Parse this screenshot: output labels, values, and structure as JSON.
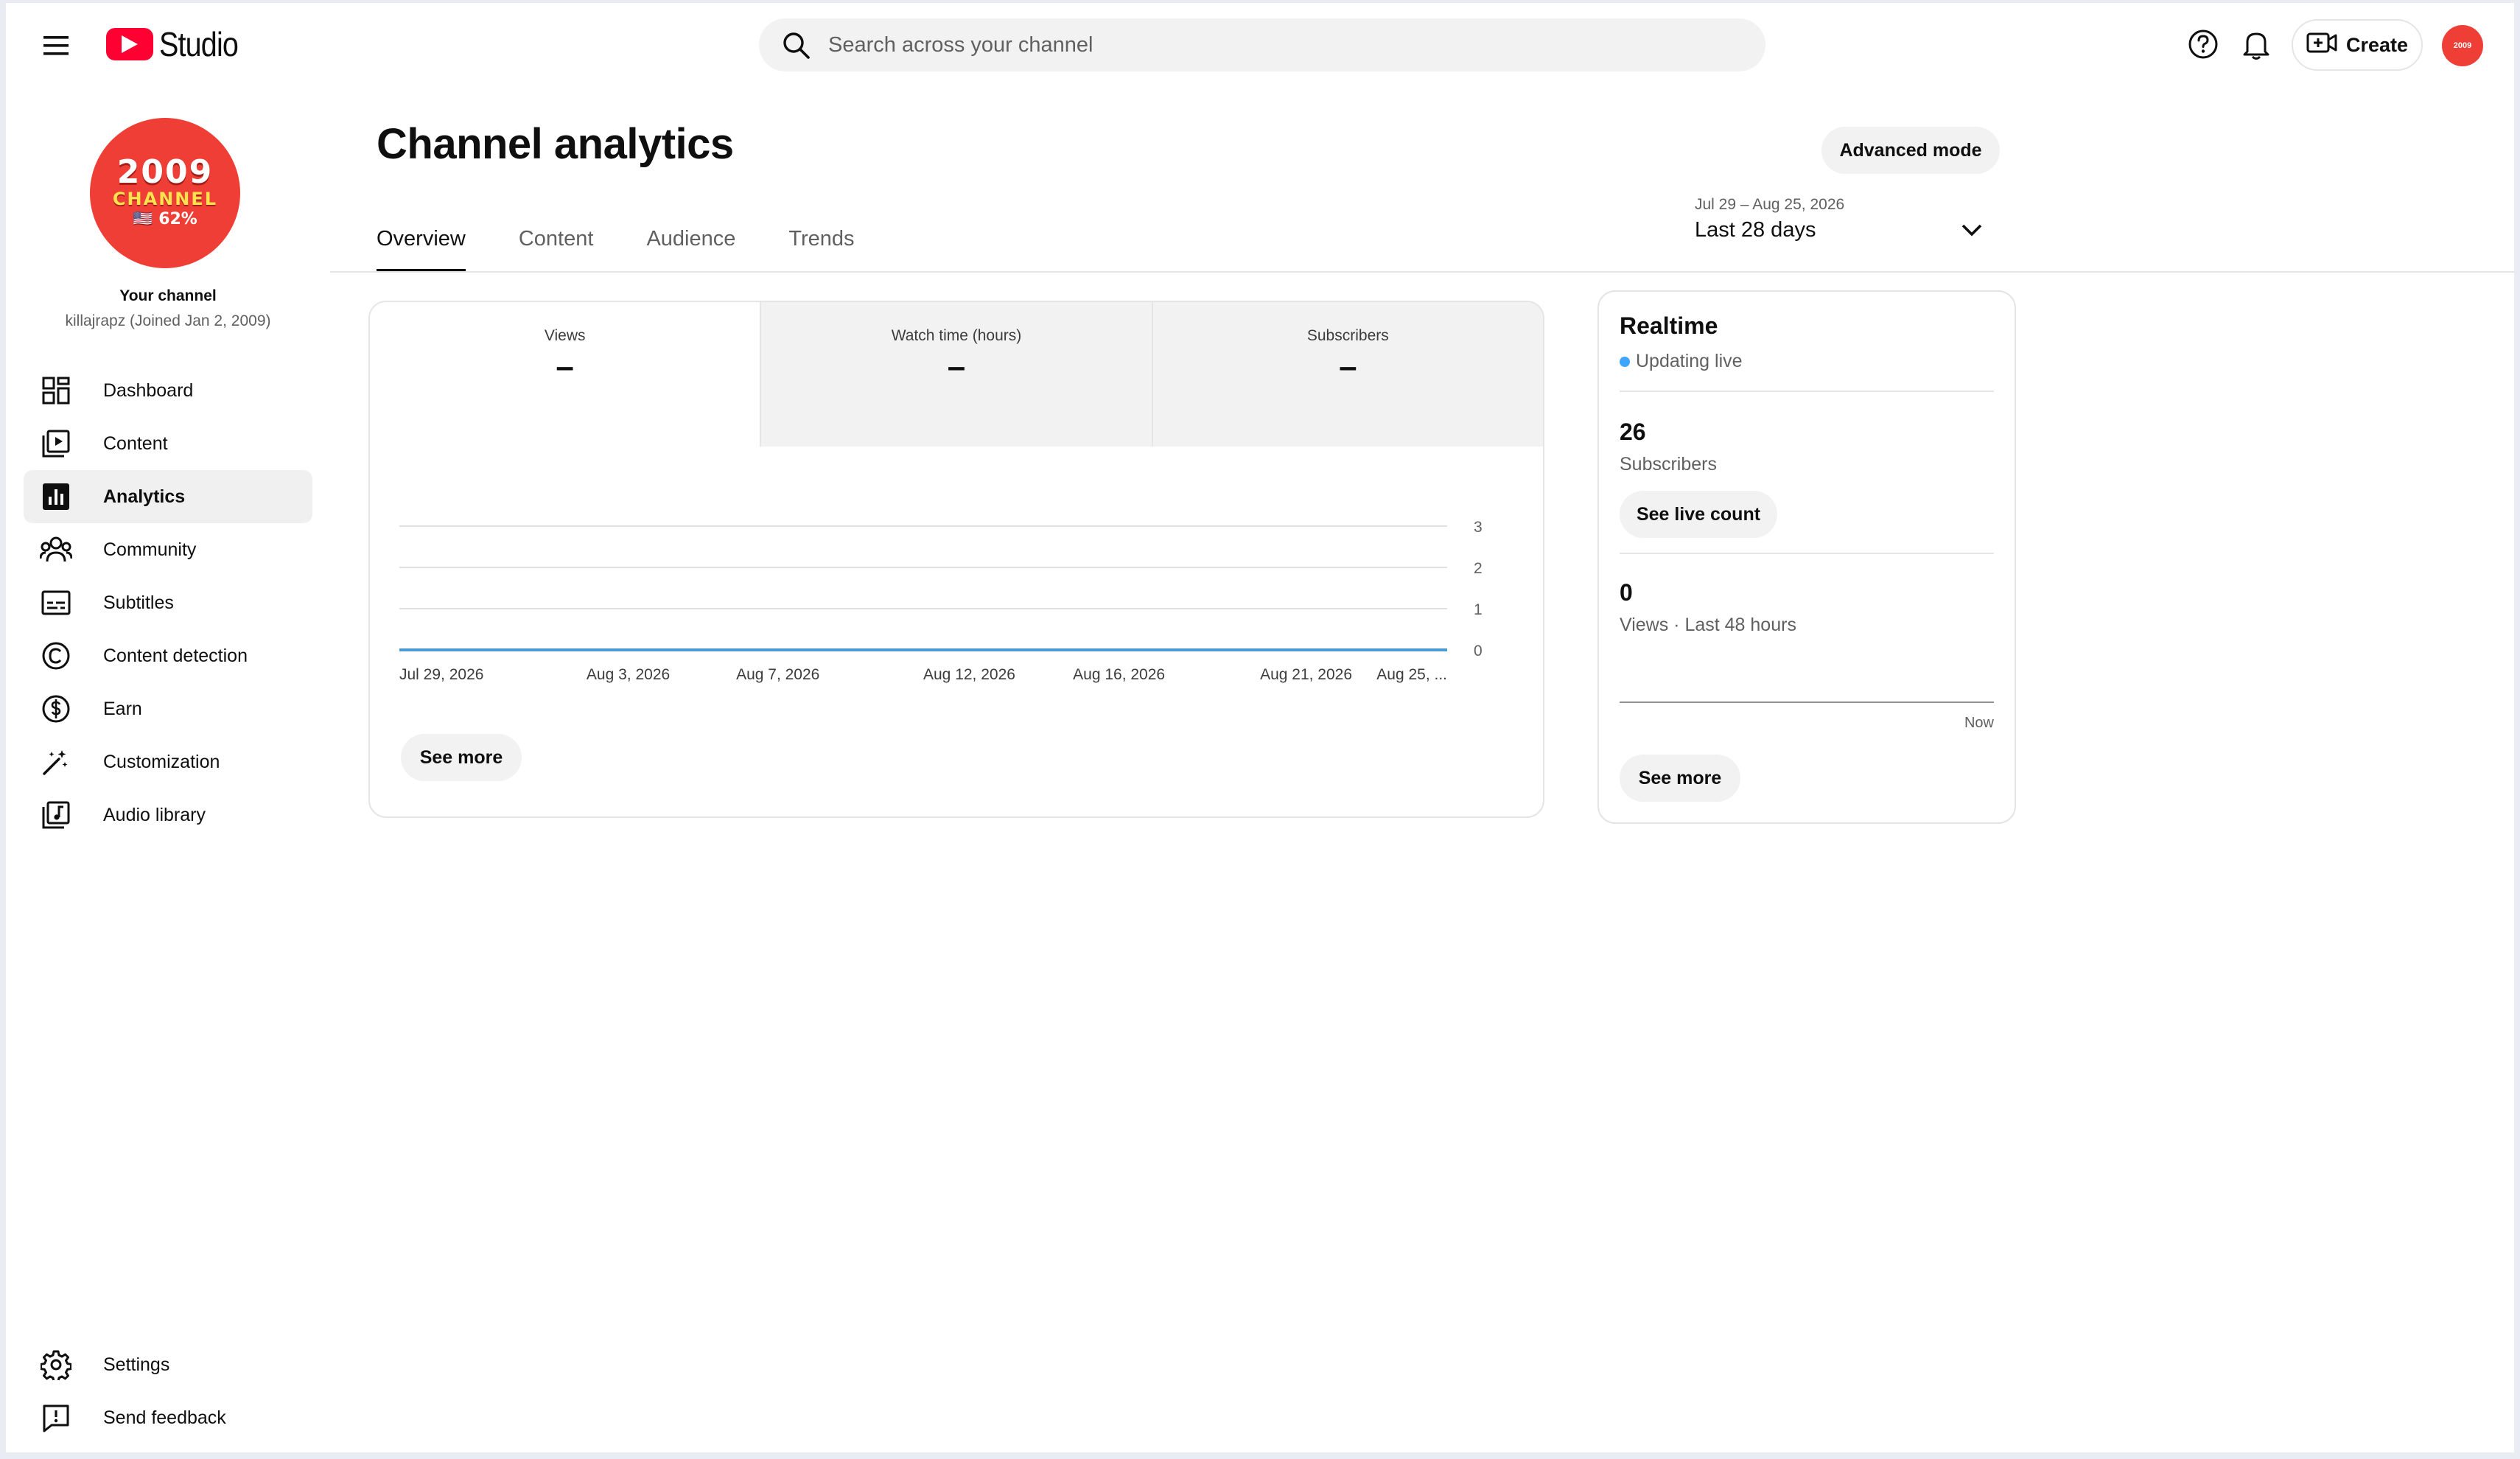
{
  "header": {
    "app_name": "Studio",
    "search_placeholder": "Search across your channel",
    "create_label": "Create"
  },
  "sidebar": {
    "avatar_lines": [
      "2009",
      "CHANNEL",
      "🇺🇸 62%"
    ],
    "your_channel": "Your channel",
    "handle": "killajrapz (Joined Jan 2, 2009)",
    "items": [
      {
        "label": "Dashboard",
        "icon": "dashboard-icon"
      },
      {
        "label": "Content",
        "icon": "content-icon"
      },
      {
        "label": "Analytics",
        "icon": "analytics-icon",
        "active": true
      },
      {
        "label": "Community",
        "icon": "community-icon"
      },
      {
        "label": "Subtitles",
        "icon": "subtitles-icon"
      },
      {
        "label": "Content detection",
        "icon": "copyright-icon"
      },
      {
        "label": "Earn",
        "icon": "dollar-icon"
      },
      {
        "label": "Customization",
        "icon": "magic-wand-icon"
      },
      {
        "label": "Audio library",
        "icon": "audio-library-icon"
      }
    ],
    "bottom_items": [
      {
        "label": "Settings",
        "icon": "gear-icon"
      },
      {
        "label": "Send feedback",
        "icon": "feedback-icon"
      }
    ]
  },
  "main": {
    "title": "Channel analytics",
    "advanced_mode": "Advanced mode",
    "tabs": [
      {
        "label": "Overview",
        "active": true
      },
      {
        "label": "Content"
      },
      {
        "label": "Audience"
      },
      {
        "label": "Trends"
      }
    ],
    "date_range": {
      "dates": "Jul 29 – Aug 25, 2026",
      "period": "Last 28 days"
    },
    "metrics": [
      {
        "label": "Views",
        "value": "–",
        "active": true
      },
      {
        "label": "Watch time (hours)",
        "value": "–"
      },
      {
        "label": "Subscribers",
        "value": "–"
      }
    ],
    "see_more": "See more"
  },
  "chart_data": {
    "type": "line",
    "x": [
      "Jul 29, 2026",
      "Aug 3, 2026",
      "Aug 7, 2026",
      "Aug 12, 2026",
      "Aug 16, 2026",
      "Aug 21, 2026",
      "Aug 25, ..."
    ],
    "series": [
      {
        "values": [
          0,
          0,
          0,
          0,
          0,
          0,
          0
        ],
        "color": "#4a9ad4"
      }
    ],
    "y_ticks": [
      0,
      1,
      2,
      3
    ],
    "ylim": [
      0,
      3
    ],
    "grid": true,
    "y_axis_side": "right"
  },
  "realtime": {
    "title": "Realtime",
    "live_label": "Updating live",
    "subscribers_value": "26",
    "subscribers_label": "Subscribers",
    "live_count_button": "See live count",
    "views_value": "0",
    "views_label": "Views · Last 48 hours",
    "axis_end_label": "Now",
    "see_more": "See more"
  },
  "colors": {
    "brand_red": "#ff0033",
    "accent_blue": "#3ea6ff",
    "line_blue": "#4a9ad4"
  }
}
